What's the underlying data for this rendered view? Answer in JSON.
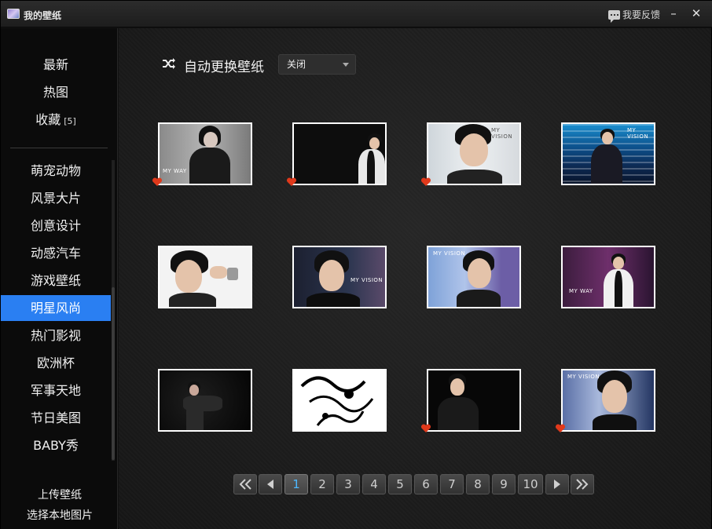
{
  "window": {
    "title": "我的壁纸",
    "feedback_label": "我要反馈",
    "minimize_glyph": "–",
    "close_glyph": "✕"
  },
  "sidebar": {
    "top_items": [
      {
        "label": "最新"
      },
      {
        "label": "热图"
      },
      {
        "label": "收藏",
        "badge": "[5]"
      }
    ],
    "categories": [
      {
        "label": "萌宠动物"
      },
      {
        "label": "风景大片"
      },
      {
        "label": "创意设计"
      },
      {
        "label": "动感汽车"
      },
      {
        "label": "游戏壁纸"
      },
      {
        "label": "明星风尚",
        "active": true
      },
      {
        "label": "热门影视"
      },
      {
        "label": "欧洲杯"
      },
      {
        "label": "军事天地"
      },
      {
        "label": "节日美图"
      },
      {
        "label": "BABY秀"
      }
    ],
    "upload_label": "上传壁纸",
    "local_label": "选择本地图片"
  },
  "toolbar": {
    "auto_change_label": "自动更换壁纸",
    "auto_change_value": "关闭",
    "shuffle_icon": "shuffle-icon"
  },
  "thumbnails": [
    {
      "favorited": true,
      "watermark": "MY WAY"
    },
    {
      "favorited": true,
      "watermark": ""
    },
    {
      "favorited": true,
      "watermark": "MY VISION"
    },
    {
      "favorited": false,
      "watermark": "MY VISION"
    },
    {
      "favorited": false,
      "watermark": ""
    },
    {
      "favorited": false,
      "watermark": "MY VISION"
    },
    {
      "favorited": false,
      "watermark": "MY VISION"
    },
    {
      "favorited": false,
      "watermark": "MY WAY"
    },
    {
      "favorited": false,
      "watermark": ""
    },
    {
      "favorited": false,
      "watermark": ""
    },
    {
      "favorited": true,
      "watermark": ""
    },
    {
      "favorited": true,
      "watermark": "MY VISION"
    }
  ],
  "pagination": {
    "first_icon": "double-chevron-left-icon",
    "prev_icon": "triangle-left-icon",
    "pages": [
      "1",
      "2",
      "3",
      "4",
      "5",
      "6",
      "7",
      "8",
      "9",
      "10"
    ],
    "current": "1",
    "next_icon": "triangle-right-icon",
    "last_icon": "double-chevron-right-icon"
  },
  "colors": {
    "accent": "#2a7ff2",
    "heart": "#e0391b",
    "current_page": "#4db8ff"
  }
}
